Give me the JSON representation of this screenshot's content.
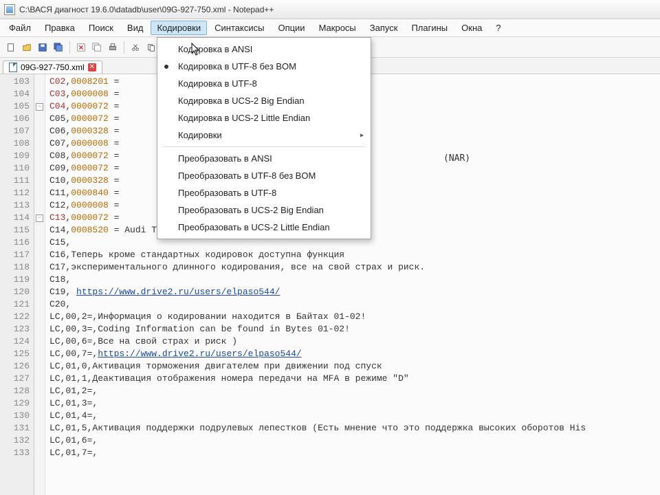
{
  "window": {
    "title": "C:\\ВАСЯ диагност 19.6.0\\datadb\\user\\09G-927-750.xml - Notepad++"
  },
  "menubar": [
    "Файл",
    "Правка",
    "Поиск",
    "Вид",
    "Кодировки",
    "Синтаксисы",
    "Опции",
    "Макросы",
    "Запуск",
    "Плагины",
    "Окна",
    "?"
  ],
  "active_menu_index": 4,
  "dropdown": {
    "groups": [
      [
        {
          "label": "Кодировка в ANSI"
        },
        {
          "label": "Кодировка в UTF-8 без BOM",
          "checked": true
        },
        {
          "label": "Кодировка в UTF-8"
        },
        {
          "label": "Кодировка в UCS-2 Big Endian"
        },
        {
          "label": "Кодировка в UCS-2 Little Endian"
        },
        {
          "label": "Кодировки",
          "submenu": true
        }
      ],
      [
        {
          "label": "Преобразовать в ANSI"
        },
        {
          "label": "Преобразовать в UTF-8 без BOM"
        },
        {
          "label": "Преобразовать в UTF-8"
        },
        {
          "label": "Преобразовать в UCS-2 Big Endian"
        },
        {
          "label": "Преобразовать в UCS-2 Little Endian"
        }
      ]
    ]
  },
  "tab": {
    "name": "09G-927-750.xml"
  },
  "lines": [
    {
      "n": 103,
      "segs": [
        {
          "t": "C02",
          "c": "red"
        },
        {
          "t": ",",
          "c": "txt"
        },
        {
          "t": "0008201",
          "c": "ora"
        },
        {
          "t": " = ",
          "c": "txt"
        }
      ]
    },
    {
      "n": 104,
      "segs": [
        {
          "t": "C03",
          "c": "red"
        },
        {
          "t": ",",
          "c": "txt"
        },
        {
          "t": "0000008",
          "c": "ora"
        },
        {
          "t": " = ",
          "c": "txt"
        }
      ]
    },
    {
      "n": 105,
      "fold": true,
      "segs": [
        {
          "t": "C04",
          "c": "red"
        },
        {
          "t": ",",
          "c": "txt"
        },
        {
          "t": "0000072",
          "c": "ora"
        },
        {
          "t": " = ",
          "c": "txt"
        }
      ]
    },
    {
      "n": 106,
      "segs": [
        {
          "t": "C05",
          "c": "txt"
        },
        {
          "t": ",",
          "c": "txt"
        },
        {
          "t": "0000072",
          "c": "ora"
        },
        {
          "t": " = ",
          "c": "txt"
        }
      ]
    },
    {
      "n": 107,
      "segs": [
        {
          "t": "C06",
          "c": "txt"
        },
        {
          "t": ",",
          "c": "txt"
        },
        {
          "t": "0000328",
          "c": "ora"
        },
        {
          "t": " = ",
          "c": "txt"
        }
      ]
    },
    {
      "n": 108,
      "segs": [
        {
          "t": "C07",
          "c": "txt"
        },
        {
          "t": ",",
          "c": "txt"
        },
        {
          "t": "0000008",
          "c": "ora"
        },
        {
          "t": " = ",
          "c": "txt"
        }
      ]
    },
    {
      "n": 109,
      "segs": [
        {
          "t": "C08",
          "c": "txt"
        },
        {
          "t": ",",
          "c": "txt"
        },
        {
          "t": "0000072",
          "c": "ora"
        },
        {
          "t": " = ",
          "c": "txt"
        }
      ]
    },
    {
      "n": 110,
      "segs": [
        {
          "t": "C09",
          "c": "txt"
        },
        {
          "t": ",",
          "c": "txt"
        },
        {
          "t": "0000072",
          "c": "ora"
        },
        {
          "t": " = ",
          "c": "txt"
        }
      ]
    },
    {
      "n": 111,
      "segs": [
        {
          "t": "C10",
          "c": "txt"
        },
        {
          "t": ",",
          "c": "txt"
        },
        {
          "t": "0000328",
          "c": "ora"
        },
        {
          "t": " = ",
          "c": "txt"
        }
      ]
    },
    {
      "n": 112,
      "segs": [
        {
          "t": "C11",
          "c": "txt"
        },
        {
          "t": ",",
          "c": "txt"
        },
        {
          "t": "0000840",
          "c": "ora"
        },
        {
          "t": " = ",
          "c": "txt"
        }
      ]
    },
    {
      "n": 113,
      "segs": [
        {
          "t": "C12",
          "c": "txt"
        },
        {
          "t": ",",
          "c": "txt"
        },
        {
          "t": "0000008",
          "c": "ora"
        },
        {
          "t": " = ",
          "c": "txt"
        }
      ]
    },
    {
      "n": 114,
      "fold": true,
      "segs": [
        {
          "t": "C13",
          "c": "red"
        },
        {
          "t": ",",
          "c": "txt"
        },
        {
          "t": "0000072",
          "c": "ora"
        },
        {
          "t": " = ",
          "c": "txt"
        }
      ]
    },
    {
      "n": 115,
      "segs": [
        {
          "t": "C14",
          "c": "txt"
        },
        {
          "t": ",",
          "c": "txt"
        },
        {
          "t": "0008520",
          "c": "ora"
        },
        {
          "t": " = Audi TT RS",
          "c": "txt"
        }
      ]
    },
    {
      "n": 116,
      "segs": [
        {
          "t": "C15,",
          "c": "txt"
        }
      ]
    },
    {
      "n": 117,
      "segs": [
        {
          "t": "C16,Теперь кроме стандартных кодировок доступна функция",
          "c": "txt"
        }
      ]
    },
    {
      "n": 118,
      "segs": [
        {
          "t": "C17,экспериментального длинного кодирования, все на свой страх и риск.",
          "c": "txt"
        }
      ]
    },
    {
      "n": 119,
      "segs": [
        {
          "t": "C18,",
          "c": "txt"
        }
      ]
    },
    {
      "n": 120,
      "segs": [
        {
          "t": "C19, ",
          "c": "txt"
        },
        {
          "t": "https://www.drive2.ru/users/elpaso544/",
          "c": "link"
        }
      ]
    },
    {
      "n": 121,
      "segs": [
        {
          "t": "C20,",
          "c": "txt"
        }
      ]
    },
    {
      "n": 122,
      "segs": [
        {
          "t": "LC,00,2=,Информация о кодировании находится в Байтах 01-02!",
          "c": "txt"
        }
      ]
    },
    {
      "n": 123,
      "segs": [
        {
          "t": "LC,00,3=,Coding Information can be found in Bytes 01-02!",
          "c": "txt"
        }
      ]
    },
    {
      "n": 124,
      "segs": [
        {
          "t": "LC,00,6=,Все на свой страх и риск )",
          "c": "txt"
        }
      ]
    },
    {
      "n": 125,
      "segs": [
        {
          "t": "LC,00,7=,",
          "c": "txt"
        },
        {
          "t": "https://www.drive2.ru/users/elpaso544/",
          "c": "link"
        }
      ]
    },
    {
      "n": 126,
      "segs": [
        {
          "t": "LC,01,0,Активация торможения двигателем при движении под спуск",
          "c": "txt"
        }
      ]
    },
    {
      "n": 127,
      "segs": [
        {
          "t": "LC,01,1,Деактивация отображения номера передачи на MFA в режиме \"D\"",
          "c": "txt"
        }
      ]
    },
    {
      "n": 128,
      "segs": [
        {
          "t": "LC,01,2=,",
          "c": "txt"
        }
      ]
    },
    {
      "n": 129,
      "segs": [
        {
          "t": "LC,01,3=,",
          "c": "txt"
        }
      ]
    },
    {
      "n": 130,
      "segs": [
        {
          "t": "LC,01,4=,",
          "c": "txt"
        }
      ]
    },
    {
      "n": 131,
      "segs": [
        {
          "t": "LC,01,5,Активация поддержки подрулевых лепестков (Есть мнение что это поддержка высоких оборотов His",
          "c": "txt"
        }
      ]
    },
    {
      "n": 132,
      "segs": [
        {
          "t": "LC,01,6=,",
          "c": "txt"
        }
      ]
    },
    {
      "n": 133,
      "segs": [
        {
          "t": "LC,01,7=,",
          "c": "txt"
        }
      ]
    }
  ],
  "nar_text": "(NAR)"
}
